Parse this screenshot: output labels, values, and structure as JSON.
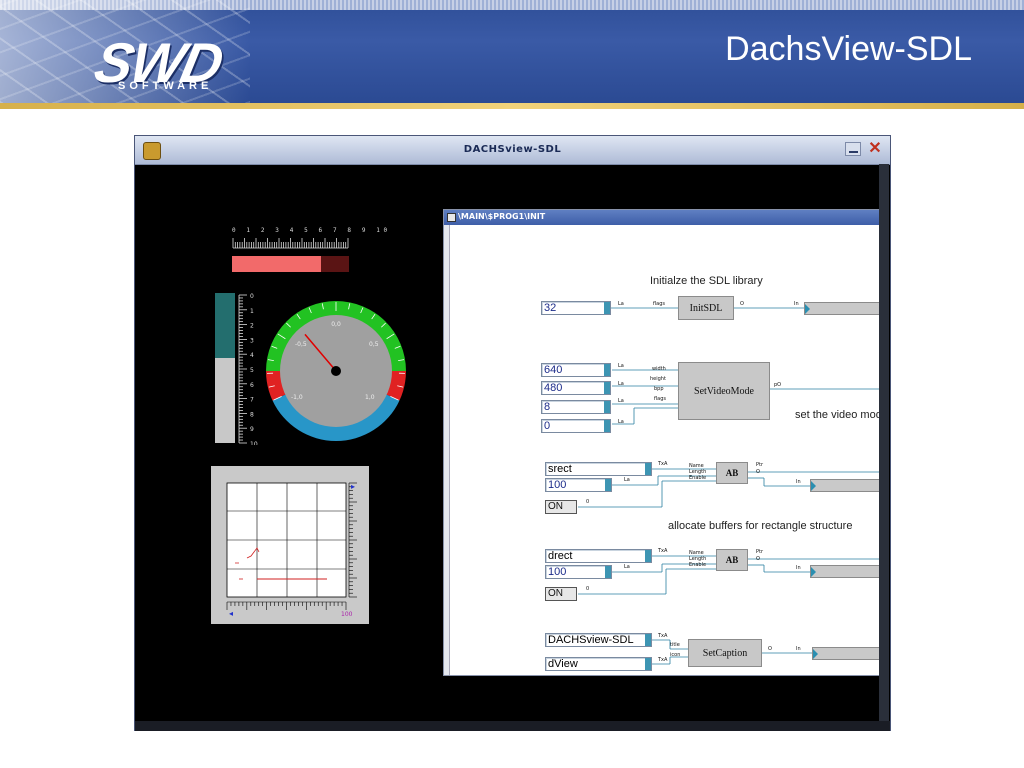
{
  "slide": {
    "logo_text": "SWD",
    "logo_subtitle": "SOFTWARE",
    "title": "DachsView-SDL"
  },
  "window": {
    "title": "DACHSview-SDL",
    "minimize_label": "",
    "close_label": "✕"
  },
  "hbar": {
    "scale_labels": "0 1 2 3 4 5 6 7 8 9 10",
    "value_fraction": 0.76,
    "fill_color": "#f26a6a",
    "track_color": "#5a1414"
  },
  "vbar": {
    "scale_labels": [
      "0",
      "1",
      "2",
      "3",
      "4",
      "5",
      "6",
      "7",
      "8",
      "9",
      "10"
    ],
    "value_fraction": 0.43,
    "fill_color": "#236e6e",
    "track_color": "#c8c8c8"
  },
  "gauge": {
    "labels": [
      "0,0",
      "-0,5",
      "0,5",
      "-1,0",
      "1,0"
    ],
    "needle_value": -0.35,
    "min": -1.0,
    "max": 1.0,
    "colors": {
      "green": "#22c222",
      "red": "#e02222",
      "blue": "#2896c8",
      "face": "#a0a0a0"
    }
  },
  "plot": {
    "x_end_label": "100",
    "marker_left": "◂",
    "marker_right": "▸"
  },
  "diagram": {
    "title": "\\MAIN\\$PROG1\\INIT",
    "comments": {
      "init": "Initialze the SDL library",
      "video": "set the video mod",
      "alloc": "allocate buffers for rectangle structure"
    },
    "init_sdl": {
      "block": "InitSDL",
      "input_value": "32",
      "pin_in": "flags",
      "pin_type": "La",
      "pin_out": "O",
      "pin_out2": "In"
    },
    "video_mode": {
      "block": "SetVideoMode",
      "inputs": [
        "640",
        "480",
        "8",
        "0"
      ],
      "pins": [
        "width",
        "height",
        "bpp",
        "flags"
      ],
      "pin_type": "La",
      "pin_out": "pO"
    },
    "alloc1": {
      "block": "AB",
      "name_value": "srect",
      "length_value": "100",
      "switch": "ON",
      "pins": [
        "Name",
        "Length",
        "Enable"
      ],
      "pin_type_a": "TxA",
      "pin_type_b": "La",
      "pin_out": "Ptr",
      "pin_out_b": "O",
      "pin_zero": "0",
      "pin_in": "In"
    },
    "alloc2": {
      "block": "AB",
      "name_value": "drect",
      "length_value": "100",
      "switch": "ON",
      "pins": [
        "Name",
        "Length",
        "Enable"
      ],
      "pin_type_a": "TxA",
      "pin_type_b": "La",
      "pin_out": "Ptr",
      "pin_out_b": "O",
      "pin_zero": "0",
      "pin_in": "In"
    },
    "caption": {
      "block": "SetCaption",
      "title_value": "DACHSview-SDL",
      "icon_value": "dView",
      "pins": [
        "title",
        "icon"
      ],
      "pin_type": "TxA",
      "pin_out": "O",
      "pin_in": "In"
    }
  }
}
